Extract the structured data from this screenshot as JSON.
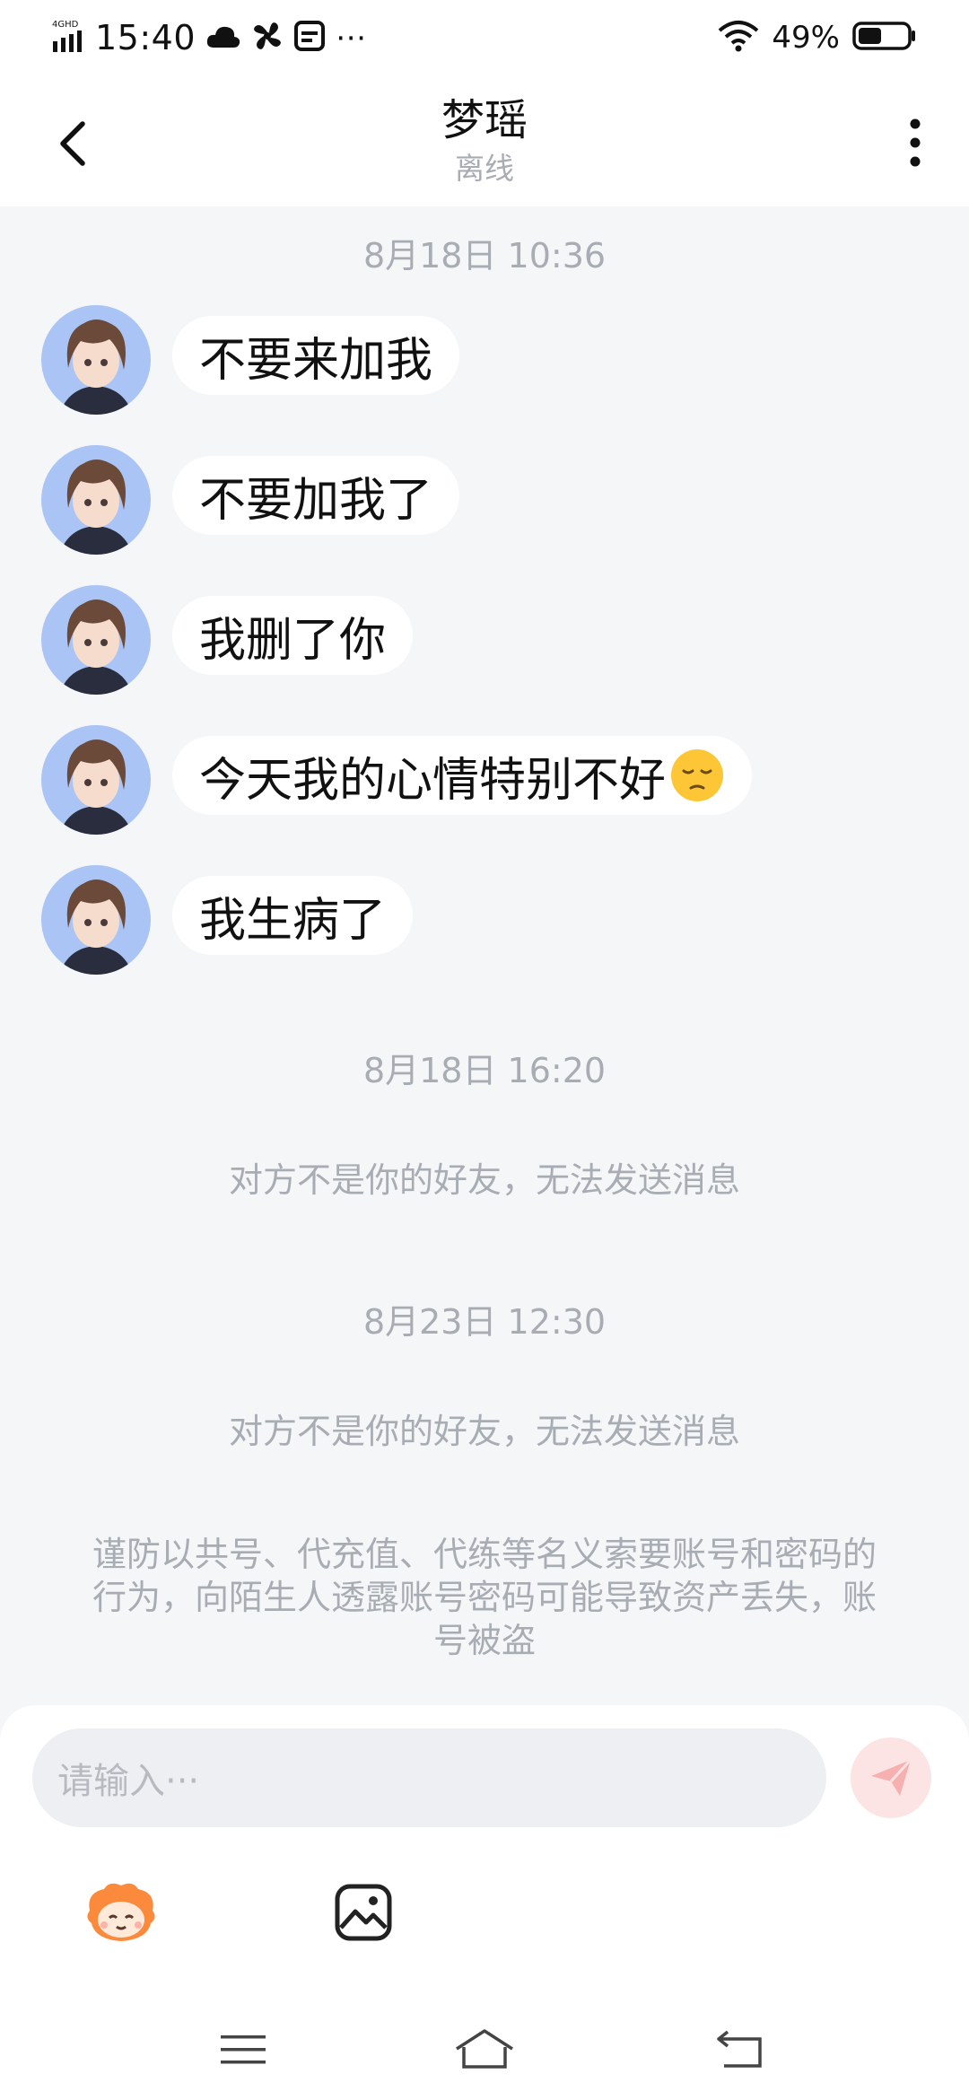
{
  "status_bar": {
    "network": "4GHD",
    "time": "15:40",
    "battery": "49%",
    "battery_level": 0.49
  },
  "header": {
    "title": "梦瑶",
    "subtitle": "离线"
  },
  "chat": {
    "timestamp_1": "8月18日 10:36",
    "messages": [
      {
        "text": "不要来加我"
      },
      {
        "text": "不要加我了"
      },
      {
        "text": "我删了你"
      },
      {
        "text": "今天我的心情特别不好",
        "emoji": "pensive-face"
      },
      {
        "text": "我生病了"
      }
    ],
    "timestamp_2": "8月18日 16:20",
    "system_1": "对方不是你的好友，无法发送消息",
    "timestamp_3": "8月23日 12:30",
    "system_2": "对方不是你的好友，无法发送消息",
    "warning": "谨防以共号、代充值、代练等名义索要账号和密码的行为，向陌生人透露账号密码可能导致资产丢失，账号被盗"
  },
  "input": {
    "placeholder": "请输入···"
  },
  "icons": {
    "sticker": "sticker-mascot-icon",
    "image": "image-icon",
    "send": "send-icon"
  },
  "colors": {
    "background": "#f5f6f8",
    "bubble": "#ffffff",
    "muted_text": "#a8acb3",
    "send_button": "#fde4e4",
    "send_icon": "#f7b0b0"
  }
}
